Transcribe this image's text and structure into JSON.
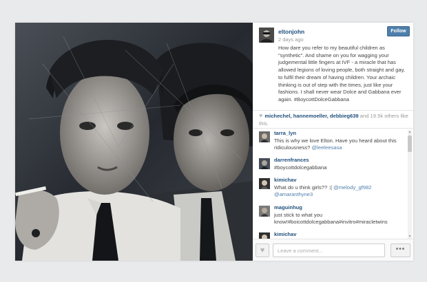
{
  "post": {
    "username": "eltonjohn",
    "time": "2 days ago",
    "follow_label": "Follow",
    "caption": "How dare you refer to my beautiful children as \"synthetic\". And shame on you for wagging your judgemental little fingers at IVF - a miracle that has allowed legions of loving people, both straight and gay, to fulfil their dream of having children. Your archaic thinking is out of step with the times, just like your fashions. I shall never wear Dolce and Gabbana ever again. #BoycottDolceGabbana"
  },
  "likes": {
    "icon": "heart-icon",
    "names": "michechel, hannemoeller, debbieg639",
    "rest": " and 19.5k others like this."
  },
  "comments": [
    {
      "user": "tarra_lyn",
      "text": "This is why we love Elton. Have you heard about this ridiculousness? ",
      "mention": "@leeleesasa"
    },
    {
      "user": "darrenfrances",
      "text": "#boycottdolcegabbana",
      "mention": ""
    },
    {
      "user": "kimichav",
      "text": "What do u think girls?? :( ",
      "mention": "@melody_gf982 @amaranthyne3"
    },
    {
      "user": "maguinhug",
      "text": "just stick to what you know!#boicottdolcegabbana#invitro#miracletwins",
      "mention": ""
    },
    {
      "user": "kimichav",
      "text": "",
      "mention": ""
    }
  ],
  "footer": {
    "comment_placeholder": "Leave a comment...",
    "more_label": "•••",
    "like_icon": "heart-icon"
  },
  "colors": {
    "link": "#1f4f7c",
    "follow_button": "#4f7fab",
    "background": "#e9eaec"
  }
}
